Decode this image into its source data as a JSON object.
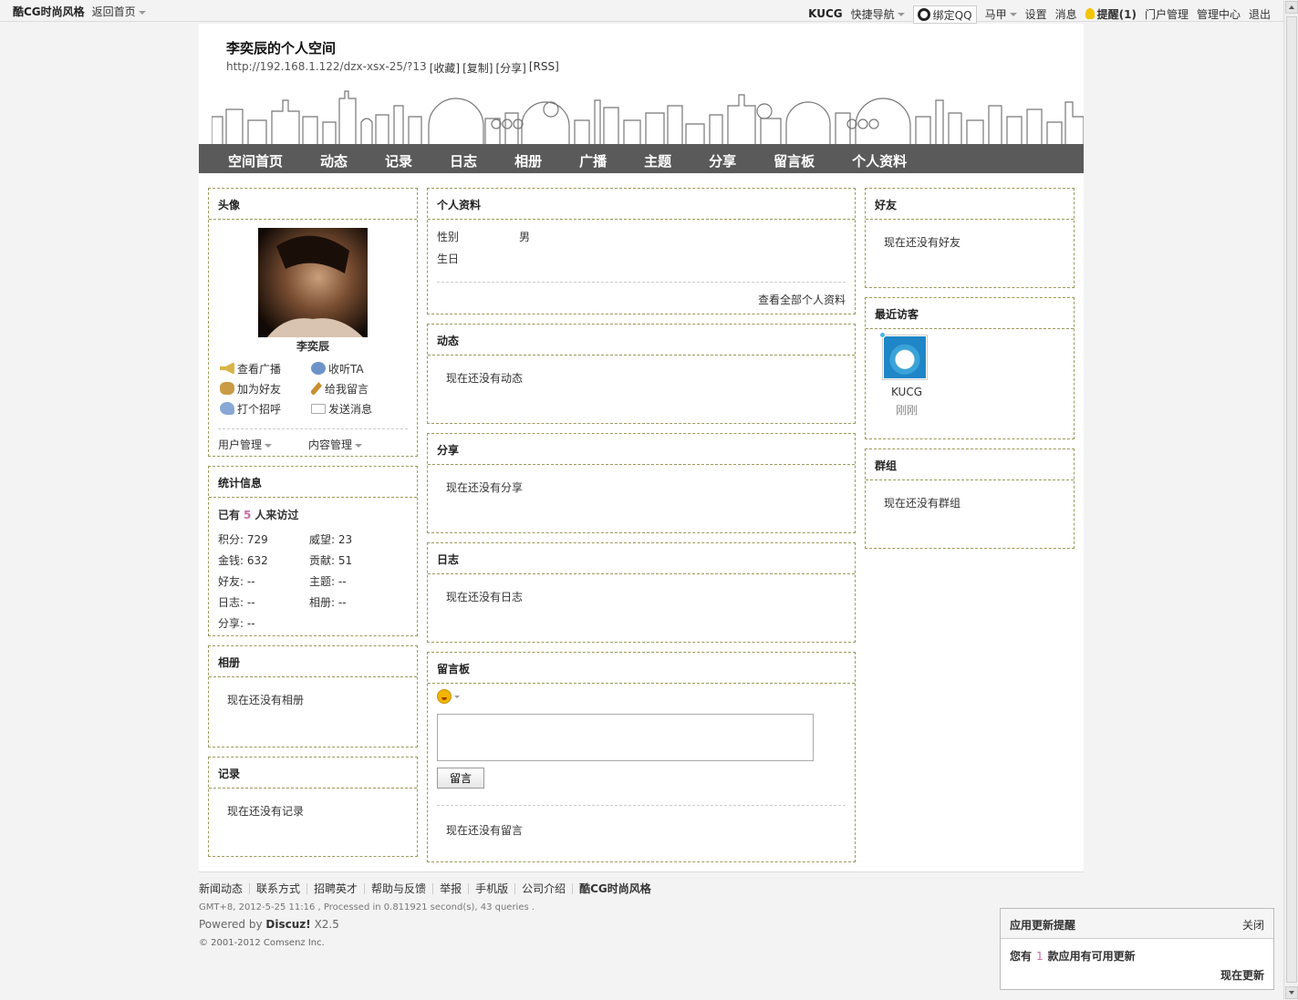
{
  "topbar": {
    "brand": "酷CG时尚风格",
    "back_home": "返回首页",
    "kucg": "KUCG",
    "quick_nav": "快捷导航",
    "bind_qq": "绑定QQ",
    "username": "马甲",
    "settings": "设置",
    "messages": "消息",
    "remind": "提醒(1)",
    "portal_admin": "门户管理",
    "admin_center": "管理中心",
    "logout": "退出"
  },
  "space": {
    "title": "李奕辰的个人空间",
    "url": "http://192.168.1.122/dzx-xsx-25/?13",
    "bookmark": "[收藏]",
    "copy": "[复制]",
    "share": "[分享]",
    "rss": "[RSS]"
  },
  "nav": [
    "空间首页",
    "动态",
    "记录",
    "日志",
    "相册",
    "广播",
    "主题",
    "分享",
    "留言板",
    "个人资料"
  ],
  "avatar_box": {
    "title": "头像",
    "name": "李奕辰",
    "actions": [
      "查看广播",
      "收听TA",
      "加为好友",
      "给我留言",
      "打个招呼",
      "发送消息"
    ],
    "user_mgmt": "用户管理",
    "content_mgmt": "内容管理"
  },
  "stats_box": {
    "title": "统计信息",
    "visits_prefix": "已有",
    "visits_count": "5",
    "visits_suffix": "人来访过",
    "items": [
      "积分: 729",
      "威望: 23",
      "金钱: 632",
      "贡献: 51",
      "好友: --",
      "主题: --",
      "日志: --",
      "相册: --",
      "分享: --"
    ]
  },
  "album_box": {
    "title": "相册",
    "empty": "现在还没有相册"
  },
  "record_box": {
    "title": "记录",
    "empty": "现在还没有记录"
  },
  "profile_box": {
    "title": "个人资料",
    "gender_label": "性别",
    "gender_value": "男",
    "birthday_label": "生日",
    "view_all": "查看全部个人资料"
  },
  "feed_box": {
    "title": "动态",
    "empty": "现在还没有动态"
  },
  "share_box": {
    "title": "分享",
    "empty": "现在还没有分享"
  },
  "blog_box": {
    "title": "日志",
    "empty": "现在还没有日志"
  },
  "guestbook_box": {
    "title": "留言板",
    "button": "留言",
    "empty": "现在还没有留言"
  },
  "friends_box": {
    "title": "好友",
    "empty": "现在还没有好友"
  },
  "visitors_box": {
    "title": "最近访客",
    "visitor_name": "KUCG",
    "visitor_time": "刚刚"
  },
  "groups_box": {
    "title": "群组",
    "empty": "现在还没有群组"
  },
  "footer": {
    "links": [
      "新闻动态",
      "联系方式",
      "招聘英才",
      "帮助与反馈",
      "举报",
      "手机版",
      "公司介绍"
    ],
    "brand": "酷CG时尚风格",
    "debug": "GMT+8, 2012-5-25 11:16 , Processed in 0.811921 second(s), 43 queries .",
    "powered_prefix": "Powered by",
    "powered_name": "Discuz!",
    "powered_version": "X2.5",
    "copyright": "© 2001-2012 Comsenz Inc."
  },
  "popup": {
    "title": "应用更新提醒",
    "close": "关闭",
    "msg_prefix": "您有",
    "msg_count": "1",
    "msg_suffix": "款应用有可用更新",
    "update_now": "现在更新"
  }
}
